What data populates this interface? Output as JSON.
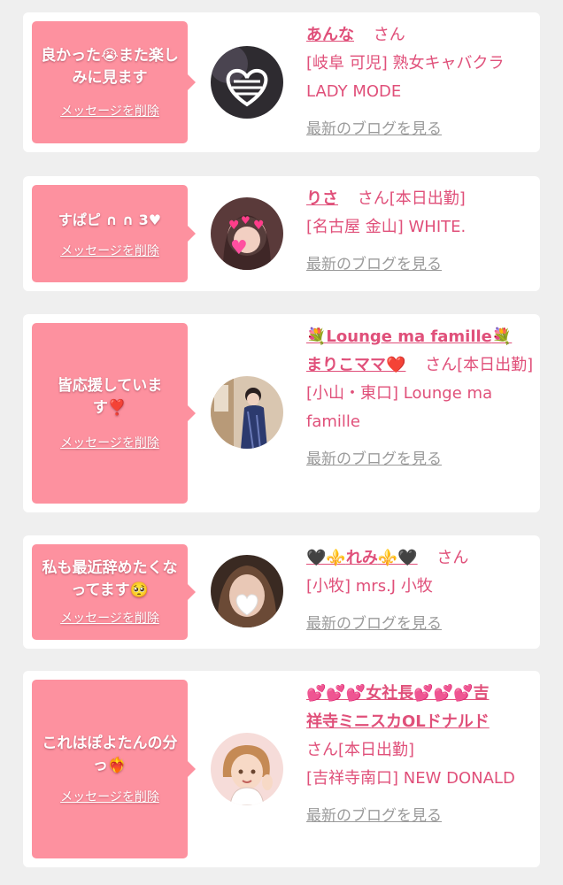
{
  "colors": {
    "background": "#efefef",
    "bubble": "#fd919f",
    "accent": "#e0507a",
    "link_gray": "#9a9a9a"
  },
  "items": [
    {
      "message": "良かった😭また楽しみに見ます",
      "delete_label": "メッセージを削除",
      "name": "あんな",
      "honorific": "さん",
      "store": "[岐阜 可児] 熟女キャバクラ LADY MODE",
      "blog_label": "最新のブログを見る"
    },
    {
      "message": "すぱピ ∩ ∩ 3♥",
      "delete_label": "メッセージを削除",
      "name": "りさ",
      "honorific": "さん",
      "status": "[本日出勤]",
      "store": "[名古屋 金山] WHITE.",
      "blog_label": "最新のブログを見る"
    },
    {
      "message": "皆応援しています❣️",
      "delete_label": "メッセージを削除",
      "name_prefix": "💐",
      "name_line1": "Lounge ma famille",
      "name_suffix": "💐",
      "name_line2": "まりこママ",
      "name_heart": "❤️",
      "honorific": "さん",
      "status": "[本日出勤]",
      "store": "[小山・東口] Lounge ma famille",
      "blog_label": "最新のブログを見る"
    },
    {
      "message": "私も最近辞めたくなってます🥺",
      "delete_label": "メッセージを削除",
      "name_prefix": "🖤⚜️",
      "name": "れみ",
      "name_suffix": "⚜️🖤",
      "honorific": "さん",
      "store": "[小牧] mrs.J 小牧",
      "blog_label": "最新のブログを見る"
    },
    {
      "message": "これはぽよたんの分っ❤️‍🔥",
      "delete_label": "メッセージを削除",
      "name_hearts": "💕💕💕",
      "name_line1": "女社長",
      "name_hearts2": "💕💕💕",
      "name_line1b": "吉",
      "name_line2": "祥寺ミニスカOLドナルド",
      "honorific": "さん",
      "status": "[本日出勤]",
      "store": "[吉祥寺南口] NEW DONALD",
      "blog_label": "最新のブログを見る"
    }
  ]
}
